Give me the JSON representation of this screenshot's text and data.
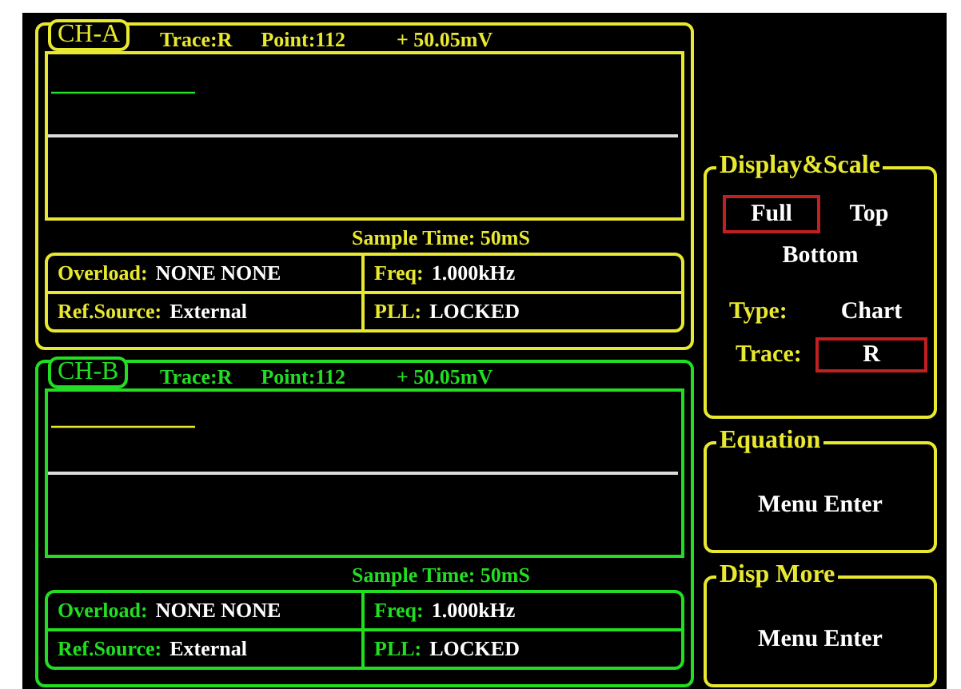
{
  "channels": [
    {
      "name": "CH-A",
      "color": "#e8e830",
      "trace": "Trace:R",
      "point": "Point:112",
      "reading": "+ 50.05mV",
      "sample_time": "Sample Time:  50mS",
      "info": [
        {
          "label": "Overload:",
          "value": "NONE NONE"
        },
        {
          "label": "Freq:",
          "value": "1.000kHz"
        },
        {
          "label": "Ref.Source:",
          "value": "External"
        },
        {
          "label": "PLL:",
          "value": "LOCKED"
        }
      ]
    },
    {
      "name": "CH-B",
      "color": "#22dd22",
      "trace": "Trace:R",
      "point": "Point:112",
      "reading": "+ 50.05mV",
      "sample_time": "Sample Time:  50mS",
      "info": [
        {
          "label": "Overload:",
          "value": "NONE NONE"
        },
        {
          "label": "Freq:",
          "value": "1.000kHz"
        },
        {
          "label": "Ref.Source:",
          "value": "External"
        },
        {
          "label": "PLL:",
          "value": "LOCKED"
        }
      ]
    }
  ],
  "display_scale": {
    "title": "Display&Scale",
    "modes": [
      {
        "label": "Full",
        "selected": true
      },
      {
        "label": "Top",
        "selected": false
      },
      {
        "label": "Bottom",
        "selected": false
      }
    ],
    "type_label": "Type:",
    "type_value": "Chart",
    "trace_label": "Trace:",
    "trace_value": "R"
  },
  "equation": {
    "title": "Equation",
    "action": "Menu Enter"
  },
  "disp_more": {
    "title": "Disp More",
    "action": "Menu Enter"
  }
}
